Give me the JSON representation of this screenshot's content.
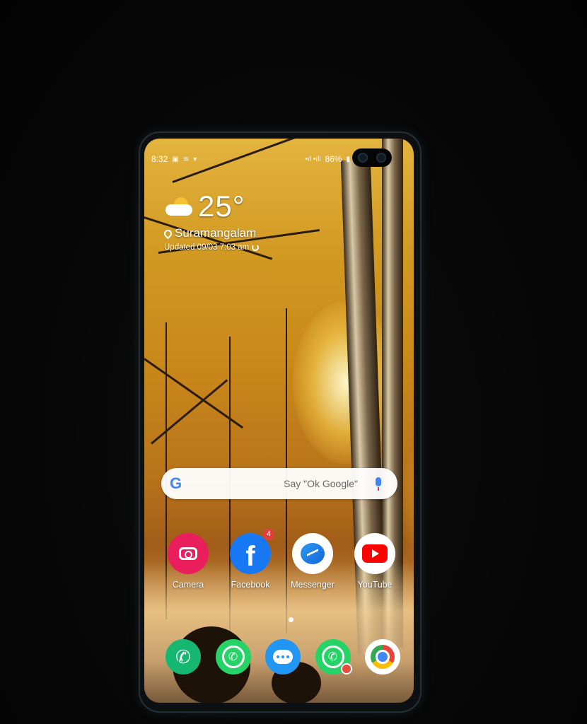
{
  "status_bar": {
    "time": "8:32",
    "battery": "86%",
    "signal": "•ıl •ıll"
  },
  "weather": {
    "temperature": "25°",
    "location": "Suramangalam",
    "updated": "Updated 09/03 7:03 am"
  },
  "search_bar": {
    "placeholder": "Say \"Ok Google\""
  },
  "apps": [
    {
      "label": "Camera"
    },
    {
      "label": "Facebook",
      "badge": "4"
    },
    {
      "label": "Messenger"
    },
    {
      "label": "YouTube"
    }
  ],
  "dock": [
    {
      "name": "Phone"
    },
    {
      "name": "WhatsApp"
    },
    {
      "name": "Messages"
    },
    {
      "name": "WhatsApp (dual)"
    },
    {
      "name": "Chrome"
    }
  ],
  "icons": [
    "google-icon",
    "mic-icon",
    "camera-icon",
    "facebook-icon",
    "messenger-icon",
    "youtube-icon",
    "phone-icon",
    "whatsapp-icon",
    "messages-icon",
    "chrome-icon"
  ]
}
